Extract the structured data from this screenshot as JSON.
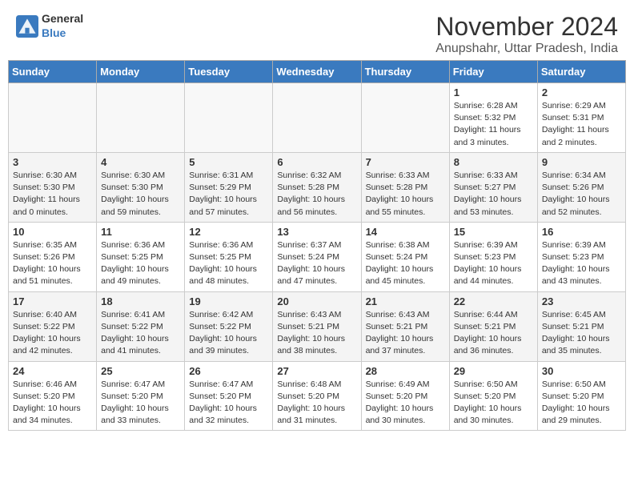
{
  "header": {
    "logo_general": "General",
    "logo_blue": "Blue",
    "month_year": "November 2024",
    "location": "Anupshahr, Uttar Pradesh, India"
  },
  "calendar": {
    "headers": [
      "Sunday",
      "Monday",
      "Tuesday",
      "Wednesday",
      "Thursday",
      "Friday",
      "Saturday"
    ],
    "rows": [
      [
        {
          "day": "",
          "info": ""
        },
        {
          "day": "",
          "info": ""
        },
        {
          "day": "",
          "info": ""
        },
        {
          "day": "",
          "info": ""
        },
        {
          "day": "",
          "info": ""
        },
        {
          "day": "1",
          "info": "Sunrise: 6:28 AM\nSunset: 5:32 PM\nDaylight: 11 hours\nand 3 minutes."
        },
        {
          "day": "2",
          "info": "Sunrise: 6:29 AM\nSunset: 5:31 PM\nDaylight: 11 hours\nand 2 minutes."
        }
      ],
      [
        {
          "day": "3",
          "info": "Sunrise: 6:30 AM\nSunset: 5:30 PM\nDaylight: 11 hours\nand 0 minutes."
        },
        {
          "day": "4",
          "info": "Sunrise: 6:30 AM\nSunset: 5:30 PM\nDaylight: 10 hours\nand 59 minutes."
        },
        {
          "day": "5",
          "info": "Sunrise: 6:31 AM\nSunset: 5:29 PM\nDaylight: 10 hours\nand 57 minutes."
        },
        {
          "day": "6",
          "info": "Sunrise: 6:32 AM\nSunset: 5:28 PM\nDaylight: 10 hours\nand 56 minutes."
        },
        {
          "day": "7",
          "info": "Sunrise: 6:33 AM\nSunset: 5:28 PM\nDaylight: 10 hours\nand 55 minutes."
        },
        {
          "day": "8",
          "info": "Sunrise: 6:33 AM\nSunset: 5:27 PM\nDaylight: 10 hours\nand 53 minutes."
        },
        {
          "day": "9",
          "info": "Sunrise: 6:34 AM\nSunset: 5:26 PM\nDaylight: 10 hours\nand 52 minutes."
        }
      ],
      [
        {
          "day": "10",
          "info": "Sunrise: 6:35 AM\nSunset: 5:26 PM\nDaylight: 10 hours\nand 51 minutes."
        },
        {
          "day": "11",
          "info": "Sunrise: 6:36 AM\nSunset: 5:25 PM\nDaylight: 10 hours\nand 49 minutes."
        },
        {
          "day": "12",
          "info": "Sunrise: 6:36 AM\nSunset: 5:25 PM\nDaylight: 10 hours\nand 48 minutes."
        },
        {
          "day": "13",
          "info": "Sunrise: 6:37 AM\nSunset: 5:24 PM\nDaylight: 10 hours\nand 47 minutes."
        },
        {
          "day": "14",
          "info": "Sunrise: 6:38 AM\nSunset: 5:24 PM\nDaylight: 10 hours\nand 45 minutes."
        },
        {
          "day": "15",
          "info": "Sunrise: 6:39 AM\nSunset: 5:23 PM\nDaylight: 10 hours\nand 44 minutes."
        },
        {
          "day": "16",
          "info": "Sunrise: 6:39 AM\nSunset: 5:23 PM\nDaylight: 10 hours\nand 43 minutes."
        }
      ],
      [
        {
          "day": "17",
          "info": "Sunrise: 6:40 AM\nSunset: 5:22 PM\nDaylight: 10 hours\nand 42 minutes."
        },
        {
          "day": "18",
          "info": "Sunrise: 6:41 AM\nSunset: 5:22 PM\nDaylight: 10 hours\nand 41 minutes."
        },
        {
          "day": "19",
          "info": "Sunrise: 6:42 AM\nSunset: 5:22 PM\nDaylight: 10 hours\nand 39 minutes."
        },
        {
          "day": "20",
          "info": "Sunrise: 6:43 AM\nSunset: 5:21 PM\nDaylight: 10 hours\nand 38 minutes."
        },
        {
          "day": "21",
          "info": "Sunrise: 6:43 AM\nSunset: 5:21 PM\nDaylight: 10 hours\nand 37 minutes."
        },
        {
          "day": "22",
          "info": "Sunrise: 6:44 AM\nSunset: 5:21 PM\nDaylight: 10 hours\nand 36 minutes."
        },
        {
          "day": "23",
          "info": "Sunrise: 6:45 AM\nSunset: 5:21 PM\nDaylight: 10 hours\nand 35 minutes."
        }
      ],
      [
        {
          "day": "24",
          "info": "Sunrise: 6:46 AM\nSunset: 5:20 PM\nDaylight: 10 hours\nand 34 minutes."
        },
        {
          "day": "25",
          "info": "Sunrise: 6:47 AM\nSunset: 5:20 PM\nDaylight: 10 hours\nand 33 minutes."
        },
        {
          "day": "26",
          "info": "Sunrise: 6:47 AM\nSunset: 5:20 PM\nDaylight: 10 hours\nand 32 minutes."
        },
        {
          "day": "27",
          "info": "Sunrise: 6:48 AM\nSunset: 5:20 PM\nDaylight: 10 hours\nand 31 minutes."
        },
        {
          "day": "28",
          "info": "Sunrise: 6:49 AM\nSunset: 5:20 PM\nDaylight: 10 hours\nand 30 minutes."
        },
        {
          "day": "29",
          "info": "Sunrise: 6:50 AM\nSunset: 5:20 PM\nDaylight: 10 hours\nand 30 minutes."
        },
        {
          "day": "30",
          "info": "Sunrise: 6:50 AM\nSunset: 5:20 PM\nDaylight: 10 hours\nand 29 minutes."
        }
      ]
    ]
  }
}
